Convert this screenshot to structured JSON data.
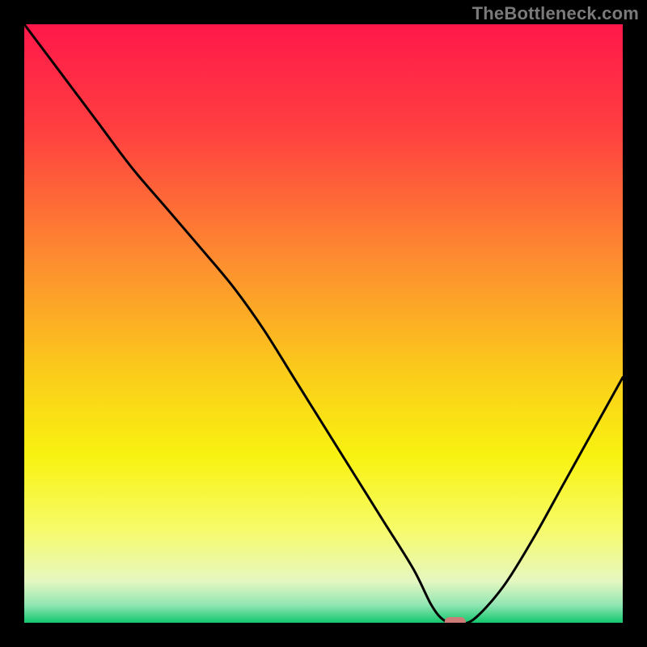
{
  "watermark": "TheBottleneck.com",
  "chart_data": {
    "type": "line",
    "title": "",
    "xlabel": "",
    "ylabel": "",
    "xlim": [
      0,
      100
    ],
    "ylim": [
      0,
      100
    ],
    "grid": false,
    "legend": false,
    "marker": {
      "x": 72,
      "y": 0,
      "color": "#cd7c78"
    },
    "gradient_stops": [
      {
        "pct": 0,
        "color": "#ff184a"
      },
      {
        "pct": 18,
        "color": "#ff4040"
      },
      {
        "pct": 40,
        "color": "#fd8f2f"
      },
      {
        "pct": 58,
        "color": "#fbcb1b"
      },
      {
        "pct": 72,
        "color": "#f8f210"
      },
      {
        "pct": 84,
        "color": "#f7fb66"
      },
      {
        "pct": 93,
        "color": "#e6f7c0"
      },
      {
        "pct": 97,
        "color": "#92e6b4"
      },
      {
        "pct": 100,
        "color": "#13c76d"
      }
    ],
    "series": [
      {
        "name": "curve",
        "x": [
          0,
          6,
          12,
          18,
          24,
          30,
          35,
          40,
          45,
          50,
          55,
          60,
          65,
          68,
          70,
          72,
          75,
          80,
          85,
          90,
          95,
          100
        ],
        "y": [
          100,
          92,
          84,
          76,
          69,
          62,
          56,
          49,
          41,
          33,
          25,
          17,
          9,
          3,
          0.5,
          0,
          0.5,
          6,
          14,
          23,
          32,
          41
        ]
      }
    ]
  }
}
